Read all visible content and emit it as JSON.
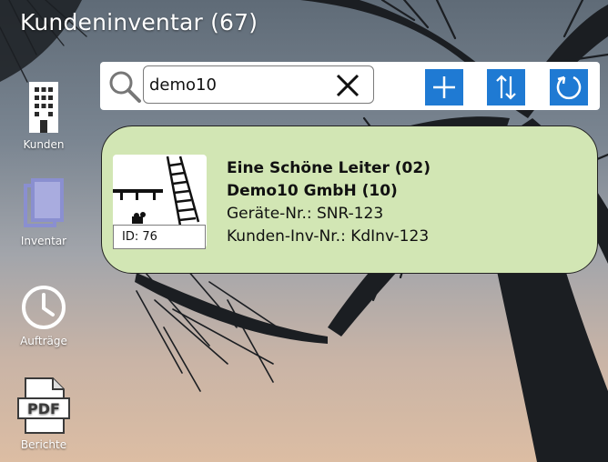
{
  "window": {
    "title": "Kundeninventar (67)"
  },
  "nav": [
    {
      "label": "Kunden",
      "icon": "building-icon"
    },
    {
      "label": "Inventar",
      "icon": "inventory-stack-icon"
    },
    {
      "label": "Aufträge",
      "icon": "clock-icon"
    },
    {
      "label": "Berichte",
      "icon": "pdf-file-icon"
    }
  ],
  "search": {
    "value": "demo10",
    "placeholder": ""
  },
  "toolbar": {
    "accent_color": "#1f7ad3"
  },
  "results": [
    {
      "name": "Eine Schöne Leiter (02)",
      "customer": "Demo10 GmbH (10)",
      "device_no": "Geräte-Nr.: SNR-123",
      "customer_inv_no": "Kunden-Inv-Nr.: KdInv-123",
      "id_label": "ID: 76",
      "card_color": "#d2e6b4"
    }
  ]
}
